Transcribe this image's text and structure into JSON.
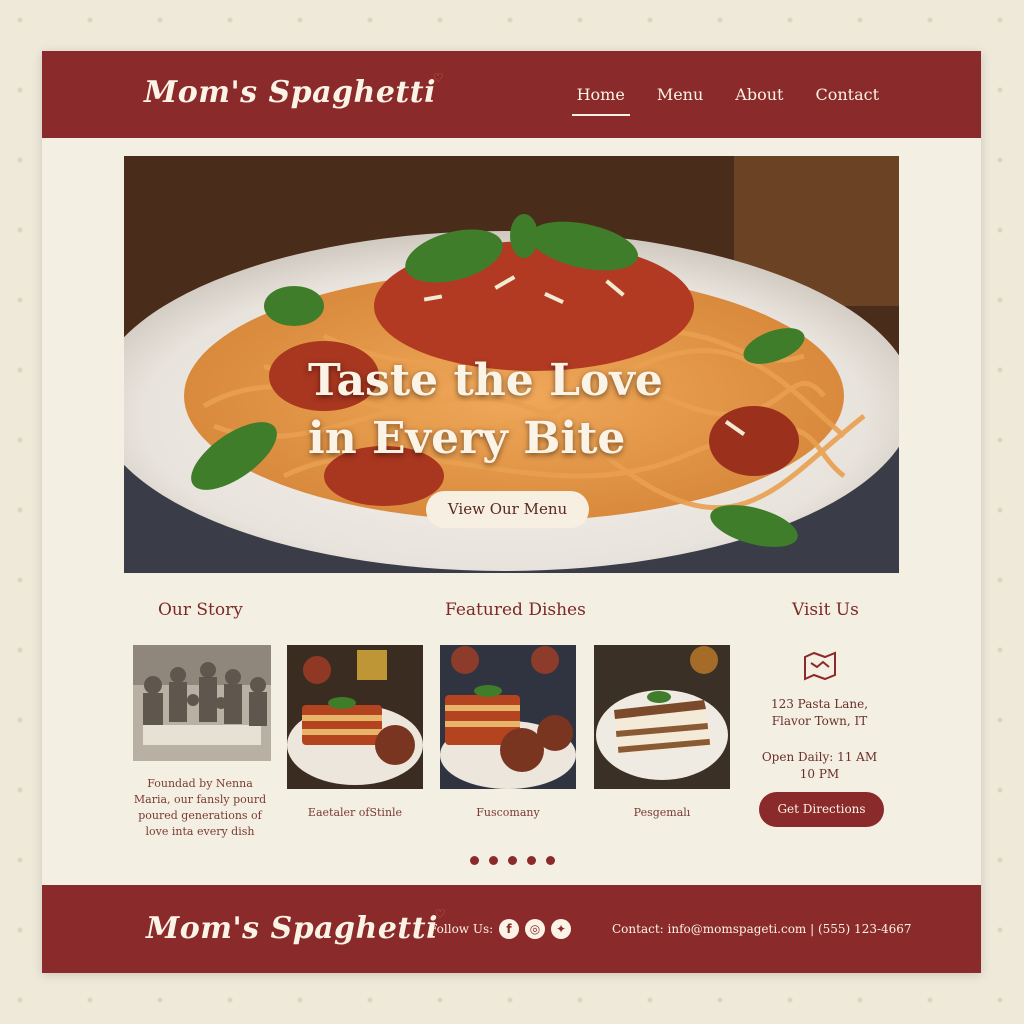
{
  "brand": {
    "name": "Mom's Spaghetti",
    "heart_glyph": "♡"
  },
  "nav": {
    "items": [
      {
        "label": "Home",
        "active": true
      },
      {
        "label": "Menu",
        "active": false
      },
      {
        "label": "About",
        "active": false
      },
      {
        "label": "Contact",
        "active": false
      }
    ]
  },
  "hero": {
    "title_line1": "Taste the Love",
    "title_line2": "in Every Bite",
    "button_label": "View Our Menu",
    "image": "spaghetti-plate-photo"
  },
  "sections": {
    "story": {
      "title": "Our Story",
      "text": "Foundad by Nenna Maria, our fansly pourd poured generations of love inta every dish",
      "image": "family-dinner-photo"
    },
    "featured": {
      "title": "Featured Dishes",
      "dishes": [
        {
          "caption": "Eaetaler ofStinle",
          "image": "lasagna-photo"
        },
        {
          "caption": "Fuscomany",
          "image": "lasagna-meatballs-photo"
        },
        {
          "caption": "Pesgemalı",
          "image": "tiramisu-photo"
        }
      ]
    },
    "visit": {
      "title": "Visit Us",
      "map_icon": "map-icon",
      "address_line1": "123 Pasta Lane,",
      "address_line2": "Flavor Town, IT",
      "hours_line1": "Open Daily: 11 AM",
      "hours_line2": "10 PM",
      "button_label": "Get Directions"
    }
  },
  "carousel": {
    "dot_count": 5
  },
  "footer": {
    "follow_label": "Follow Us:",
    "social_icons": [
      "facebook-icon",
      "instagram-icon",
      "twitter-icon"
    ],
    "contact_text": "Contact: info@momspageti.com | (555) 123-4667"
  },
  "colors": {
    "primary": "#8b2a2a",
    "cream": "#f4efe3",
    "text_dark": "#7b2a26"
  }
}
